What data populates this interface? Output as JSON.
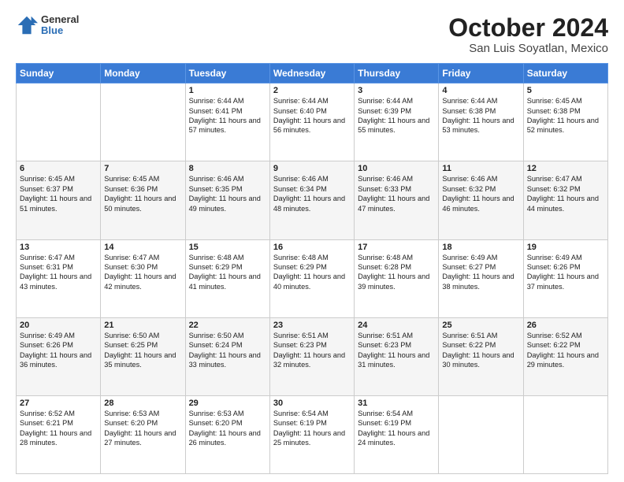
{
  "header": {
    "logo_general": "General",
    "logo_blue": "Blue",
    "month_title": "October 2024",
    "location": "San Luis Soyatlan, Mexico"
  },
  "weekdays": [
    "Sunday",
    "Monday",
    "Tuesday",
    "Wednesday",
    "Thursday",
    "Friday",
    "Saturday"
  ],
  "weeks": [
    [
      {
        "day": "",
        "sunrise": "",
        "sunset": "",
        "daylight": ""
      },
      {
        "day": "",
        "sunrise": "",
        "sunset": "",
        "daylight": ""
      },
      {
        "day": "1",
        "sunrise": "Sunrise: 6:44 AM",
        "sunset": "Sunset: 6:41 PM",
        "daylight": "Daylight: 11 hours and 57 minutes."
      },
      {
        "day": "2",
        "sunrise": "Sunrise: 6:44 AM",
        "sunset": "Sunset: 6:40 PM",
        "daylight": "Daylight: 11 hours and 56 minutes."
      },
      {
        "day": "3",
        "sunrise": "Sunrise: 6:44 AM",
        "sunset": "Sunset: 6:39 PM",
        "daylight": "Daylight: 11 hours and 55 minutes."
      },
      {
        "day": "4",
        "sunrise": "Sunrise: 6:44 AM",
        "sunset": "Sunset: 6:38 PM",
        "daylight": "Daylight: 11 hours and 53 minutes."
      },
      {
        "day": "5",
        "sunrise": "Sunrise: 6:45 AM",
        "sunset": "Sunset: 6:38 PM",
        "daylight": "Daylight: 11 hours and 52 minutes."
      }
    ],
    [
      {
        "day": "6",
        "sunrise": "Sunrise: 6:45 AM",
        "sunset": "Sunset: 6:37 PM",
        "daylight": "Daylight: 11 hours and 51 minutes."
      },
      {
        "day": "7",
        "sunrise": "Sunrise: 6:45 AM",
        "sunset": "Sunset: 6:36 PM",
        "daylight": "Daylight: 11 hours and 50 minutes."
      },
      {
        "day": "8",
        "sunrise": "Sunrise: 6:46 AM",
        "sunset": "Sunset: 6:35 PM",
        "daylight": "Daylight: 11 hours and 49 minutes."
      },
      {
        "day": "9",
        "sunrise": "Sunrise: 6:46 AM",
        "sunset": "Sunset: 6:34 PM",
        "daylight": "Daylight: 11 hours and 48 minutes."
      },
      {
        "day": "10",
        "sunrise": "Sunrise: 6:46 AM",
        "sunset": "Sunset: 6:33 PM",
        "daylight": "Daylight: 11 hours and 47 minutes."
      },
      {
        "day": "11",
        "sunrise": "Sunrise: 6:46 AM",
        "sunset": "Sunset: 6:32 PM",
        "daylight": "Daylight: 11 hours and 46 minutes."
      },
      {
        "day": "12",
        "sunrise": "Sunrise: 6:47 AM",
        "sunset": "Sunset: 6:32 PM",
        "daylight": "Daylight: 11 hours and 44 minutes."
      }
    ],
    [
      {
        "day": "13",
        "sunrise": "Sunrise: 6:47 AM",
        "sunset": "Sunset: 6:31 PM",
        "daylight": "Daylight: 11 hours and 43 minutes."
      },
      {
        "day": "14",
        "sunrise": "Sunrise: 6:47 AM",
        "sunset": "Sunset: 6:30 PM",
        "daylight": "Daylight: 11 hours and 42 minutes."
      },
      {
        "day": "15",
        "sunrise": "Sunrise: 6:48 AM",
        "sunset": "Sunset: 6:29 PM",
        "daylight": "Daylight: 11 hours and 41 minutes."
      },
      {
        "day": "16",
        "sunrise": "Sunrise: 6:48 AM",
        "sunset": "Sunset: 6:29 PM",
        "daylight": "Daylight: 11 hours and 40 minutes."
      },
      {
        "day": "17",
        "sunrise": "Sunrise: 6:48 AM",
        "sunset": "Sunset: 6:28 PM",
        "daylight": "Daylight: 11 hours and 39 minutes."
      },
      {
        "day": "18",
        "sunrise": "Sunrise: 6:49 AM",
        "sunset": "Sunset: 6:27 PM",
        "daylight": "Daylight: 11 hours and 38 minutes."
      },
      {
        "day": "19",
        "sunrise": "Sunrise: 6:49 AM",
        "sunset": "Sunset: 6:26 PM",
        "daylight": "Daylight: 11 hours and 37 minutes."
      }
    ],
    [
      {
        "day": "20",
        "sunrise": "Sunrise: 6:49 AM",
        "sunset": "Sunset: 6:26 PM",
        "daylight": "Daylight: 11 hours and 36 minutes."
      },
      {
        "day": "21",
        "sunrise": "Sunrise: 6:50 AM",
        "sunset": "Sunset: 6:25 PM",
        "daylight": "Daylight: 11 hours and 35 minutes."
      },
      {
        "day": "22",
        "sunrise": "Sunrise: 6:50 AM",
        "sunset": "Sunset: 6:24 PM",
        "daylight": "Daylight: 11 hours and 33 minutes."
      },
      {
        "day": "23",
        "sunrise": "Sunrise: 6:51 AM",
        "sunset": "Sunset: 6:23 PM",
        "daylight": "Daylight: 11 hours and 32 minutes."
      },
      {
        "day": "24",
        "sunrise": "Sunrise: 6:51 AM",
        "sunset": "Sunset: 6:23 PM",
        "daylight": "Daylight: 11 hours and 31 minutes."
      },
      {
        "day": "25",
        "sunrise": "Sunrise: 6:51 AM",
        "sunset": "Sunset: 6:22 PM",
        "daylight": "Daylight: 11 hours and 30 minutes."
      },
      {
        "day": "26",
        "sunrise": "Sunrise: 6:52 AM",
        "sunset": "Sunset: 6:22 PM",
        "daylight": "Daylight: 11 hours and 29 minutes."
      }
    ],
    [
      {
        "day": "27",
        "sunrise": "Sunrise: 6:52 AM",
        "sunset": "Sunset: 6:21 PM",
        "daylight": "Daylight: 11 hours and 28 minutes."
      },
      {
        "day": "28",
        "sunrise": "Sunrise: 6:53 AM",
        "sunset": "Sunset: 6:20 PM",
        "daylight": "Daylight: 11 hours and 27 minutes."
      },
      {
        "day": "29",
        "sunrise": "Sunrise: 6:53 AM",
        "sunset": "Sunset: 6:20 PM",
        "daylight": "Daylight: 11 hours and 26 minutes."
      },
      {
        "day": "30",
        "sunrise": "Sunrise: 6:54 AM",
        "sunset": "Sunset: 6:19 PM",
        "daylight": "Daylight: 11 hours and 25 minutes."
      },
      {
        "day": "31",
        "sunrise": "Sunrise: 6:54 AM",
        "sunset": "Sunset: 6:19 PM",
        "daylight": "Daylight: 11 hours and 24 minutes."
      },
      {
        "day": "",
        "sunrise": "",
        "sunset": "",
        "daylight": ""
      },
      {
        "day": "",
        "sunrise": "",
        "sunset": "",
        "daylight": ""
      }
    ]
  ]
}
